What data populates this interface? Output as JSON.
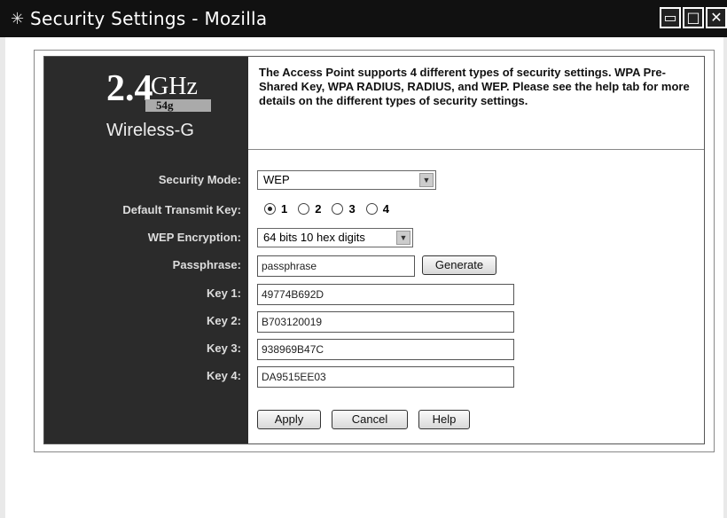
{
  "window": {
    "title": "Security Settings - Mozilla",
    "app_icon": "✳",
    "controls": [
      "▭",
      "□",
      "✕"
    ]
  },
  "logo": {
    "big": "2.4",
    "ghz": "GHz",
    "badge": "54g",
    "product": "Wireless-G"
  },
  "description": "The Access Point supports 4 different types of security settings. WPA Pre-Shared Key, WPA RADIUS, RADIUS, and WEP. Please see the help tab for more details on the different types of security settings.",
  "form": {
    "security_mode": {
      "label": "Security Mode:",
      "value": "WEP"
    },
    "default_transmit_key": {
      "label": "Default Transmit Key:",
      "options": [
        "1",
        "2",
        "3",
        "4"
      ],
      "selected": "1"
    },
    "wep_encryption": {
      "label": "WEP Encryption:",
      "value": "64 bits 10 hex digits"
    },
    "passphrase": {
      "label": "Passphrase:",
      "value": "passphrase",
      "button": "Generate"
    },
    "keys": [
      {
        "label": "Key 1:",
        "value": "49774B692D"
      },
      {
        "label": "Key 2:",
        "value": "B703120019"
      },
      {
        "label": "Key 3:",
        "value": "938969B47C"
      },
      {
        "label": "Key 4:",
        "value": "DA9515EE03"
      }
    ]
  },
  "actions": {
    "apply": "Apply",
    "cancel": "Cancel",
    "help": "Help"
  }
}
